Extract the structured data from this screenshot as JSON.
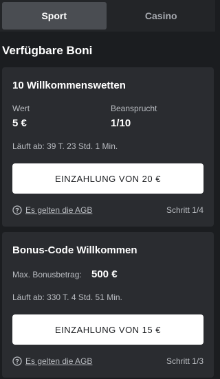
{
  "tabs": [
    {
      "label": "Sport",
      "active": true
    },
    {
      "label": "Casino",
      "active": false
    }
  ],
  "section_title": "Verfügbare Boni",
  "bonuses": [
    {
      "title": "10 Willkommenswetten",
      "value_label": "Wert",
      "value": "5 €",
      "claimed_label": "Beansprucht",
      "claimed_value": "1/10",
      "runtime": "Läuft ab: 39 T. 23 Std. 1 Min.",
      "button_label": "EINZAHLUNG VON 20 €",
      "terms_label": "Es gelten die AGB",
      "step": "Schritt 1/4"
    },
    {
      "title": "Bonus-Code Willkommen",
      "max_label": "Max. Bonusbetrag:",
      "max_value": "500 €",
      "runtime": "Läuft ab: 330 T. 4 Std. 51 Min.",
      "button_label": "EINZAHLUNG VON 15 €",
      "terms_label": "Es gelten die AGB",
      "step": "Schritt 1/3"
    }
  ]
}
